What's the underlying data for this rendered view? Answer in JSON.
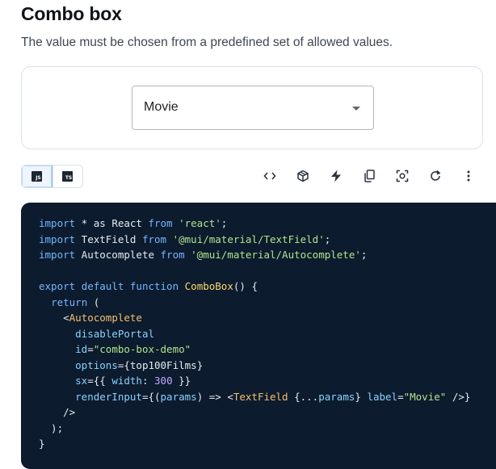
{
  "heading": {
    "title": "Combo box",
    "subtitle": "The value must be chosen from a predefined set of allowed values."
  },
  "demo": {
    "combo_value": "Movie"
  },
  "language_toggle": {
    "js_label": "JS",
    "ts_label": "TS",
    "selected": "JS"
  },
  "toolbar": {
    "icons": [
      "code-icon",
      "sandbox-icon",
      "stackblitz-icon",
      "copy-icon",
      "focus-icon",
      "reset-icon",
      "more-icon"
    ]
  },
  "code": {
    "lines": [
      [
        {
          "t": "import",
          "c": "kw"
        },
        {
          "t": " * as ",
          "c": "pl"
        },
        {
          "t": "React",
          "c": "pl"
        },
        {
          "t": " from ",
          "c": "kw"
        },
        {
          "t": "'react'",
          "c": "str"
        },
        {
          "t": ";",
          "c": "pl"
        }
      ],
      [
        {
          "t": "import",
          "c": "kw"
        },
        {
          "t": " TextField ",
          "c": "pl"
        },
        {
          "t": "from",
          "c": "kw"
        },
        {
          "t": " ",
          "c": "pl"
        },
        {
          "t": "'@mui/material/TextField'",
          "c": "str"
        },
        {
          "t": ";",
          "c": "pl"
        }
      ],
      [
        {
          "t": "import",
          "c": "kw"
        },
        {
          "t": " Autocomplete ",
          "c": "pl"
        },
        {
          "t": "from",
          "c": "kw"
        },
        {
          "t": " ",
          "c": "pl"
        },
        {
          "t": "'@mui/material/Autocomplete'",
          "c": "str"
        },
        {
          "t": ";",
          "c": "pl"
        }
      ],
      [],
      [
        {
          "t": "export",
          "c": "kw"
        },
        {
          "t": " ",
          "c": "pl"
        },
        {
          "t": "default",
          "c": "kw"
        },
        {
          "t": " ",
          "c": "pl"
        },
        {
          "t": "function",
          "c": "kw"
        },
        {
          "t": " ",
          "c": "pl"
        },
        {
          "t": "ComboBox",
          "c": "fn"
        },
        {
          "t": "() {",
          "c": "pl"
        }
      ],
      [
        {
          "t": "  ",
          "c": "pl"
        },
        {
          "t": "return",
          "c": "kw"
        },
        {
          "t": " (",
          "c": "pl"
        }
      ],
      [
        {
          "t": "    <",
          "c": "pl"
        },
        {
          "t": "Autocomplete",
          "c": "tag"
        }
      ],
      [
        {
          "t": "      ",
          "c": "pl"
        },
        {
          "t": "disablePortal",
          "c": "attr"
        }
      ],
      [
        {
          "t": "      ",
          "c": "pl"
        },
        {
          "t": "id",
          "c": "attr"
        },
        {
          "t": "=",
          "c": "pl"
        },
        {
          "t": "\"combo-box-demo\"",
          "c": "str"
        }
      ],
      [
        {
          "t": "      ",
          "c": "pl"
        },
        {
          "t": "options",
          "c": "attr"
        },
        {
          "t": "={",
          "c": "pl"
        },
        {
          "t": "top100Films",
          "c": "pl"
        },
        {
          "t": "}",
          "c": "pl"
        }
      ],
      [
        {
          "t": "      ",
          "c": "pl"
        },
        {
          "t": "sx",
          "c": "attr"
        },
        {
          "t": "={{ ",
          "c": "pl"
        },
        {
          "t": "width",
          "c": "attr"
        },
        {
          "t": ": ",
          "c": "pl"
        },
        {
          "t": "300",
          "c": "num"
        },
        {
          "t": " }}",
          "c": "pl"
        }
      ],
      [
        {
          "t": "      ",
          "c": "pl"
        },
        {
          "t": "renderInput",
          "c": "attr"
        },
        {
          "t": "={(",
          "c": "pl"
        },
        {
          "t": "params",
          "c": "attr"
        },
        {
          "t": ") => <",
          "c": "pl"
        },
        {
          "t": "TextField",
          "c": "tag"
        },
        {
          "t": " {...",
          "c": "pl"
        },
        {
          "t": "params",
          "c": "attr"
        },
        {
          "t": "} ",
          "c": "pl"
        },
        {
          "t": "label",
          "c": "attr"
        },
        {
          "t": "=",
          "c": "pl"
        },
        {
          "t": "\"Movie\"",
          "c": "str"
        },
        {
          "t": " />}",
          "c": "pl"
        }
      ],
      [
        {
          "t": "    />",
          "c": "pl"
        }
      ],
      [
        {
          "t": "  );",
          "c": "pl"
        }
      ],
      [
        {
          "t": "}",
          "c": "pl"
        }
      ]
    ]
  }
}
